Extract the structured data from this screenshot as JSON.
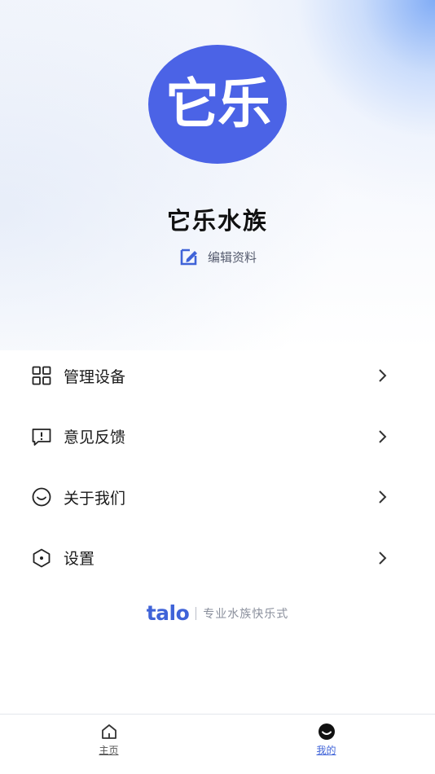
{
  "profile": {
    "avatar_text": "它乐",
    "name": "它乐水族",
    "edit_label": "编辑资料"
  },
  "menu": {
    "items": [
      {
        "label": "管理设备",
        "icon": "grid-icon"
      },
      {
        "label": "意见反馈",
        "icon": "feedback-icon"
      },
      {
        "label": "关于我们",
        "icon": "smile-icon"
      },
      {
        "label": "设置",
        "icon": "settings-icon"
      }
    ]
  },
  "brand": {
    "logo": "talo",
    "slogan": "专业水族快乐式"
  },
  "tabbar": {
    "home_label": "主页",
    "mine_label": "我的"
  },
  "colors": {
    "accent": "#3f63d8",
    "avatar_bg": "#4b63e6"
  }
}
